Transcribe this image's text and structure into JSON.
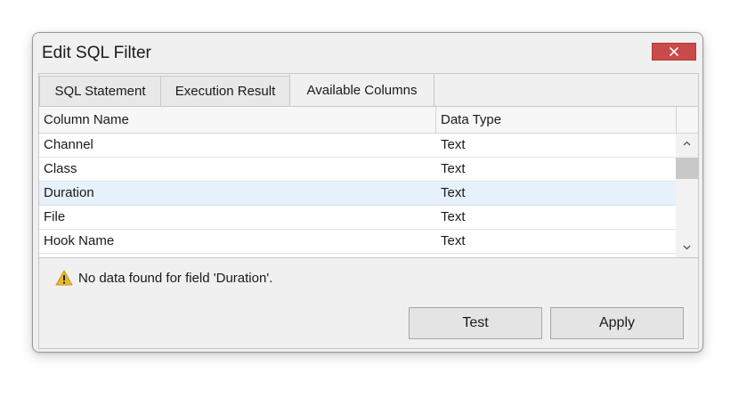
{
  "window": {
    "title": "Edit SQL Filter",
    "close_icon": "close-icon"
  },
  "tabs": [
    {
      "label": "SQL Statement",
      "active": false
    },
    {
      "label": "Execution Result",
      "active": false
    },
    {
      "label": "Available Columns",
      "active": true
    }
  ],
  "grid": {
    "columns": [
      "Column Name",
      "Data Type"
    ],
    "rows": [
      {
        "name": "Channel",
        "type": "Text",
        "selected": false
      },
      {
        "name": "Class",
        "type": "Text",
        "selected": false
      },
      {
        "name": "Duration",
        "type": "Text",
        "selected": true
      },
      {
        "name": "File",
        "type": "Text",
        "selected": false
      },
      {
        "name": "Hook Name",
        "type": "Text",
        "selected": false
      }
    ]
  },
  "status": {
    "icon": "warning-icon",
    "message": "No data found for field 'Duration'."
  },
  "buttons": {
    "test_label": "Test",
    "apply_label": "Apply"
  },
  "colors": {
    "close_button": "#c94a4a",
    "selected_row": "#e6f1fb",
    "warning": "#e8b830"
  }
}
